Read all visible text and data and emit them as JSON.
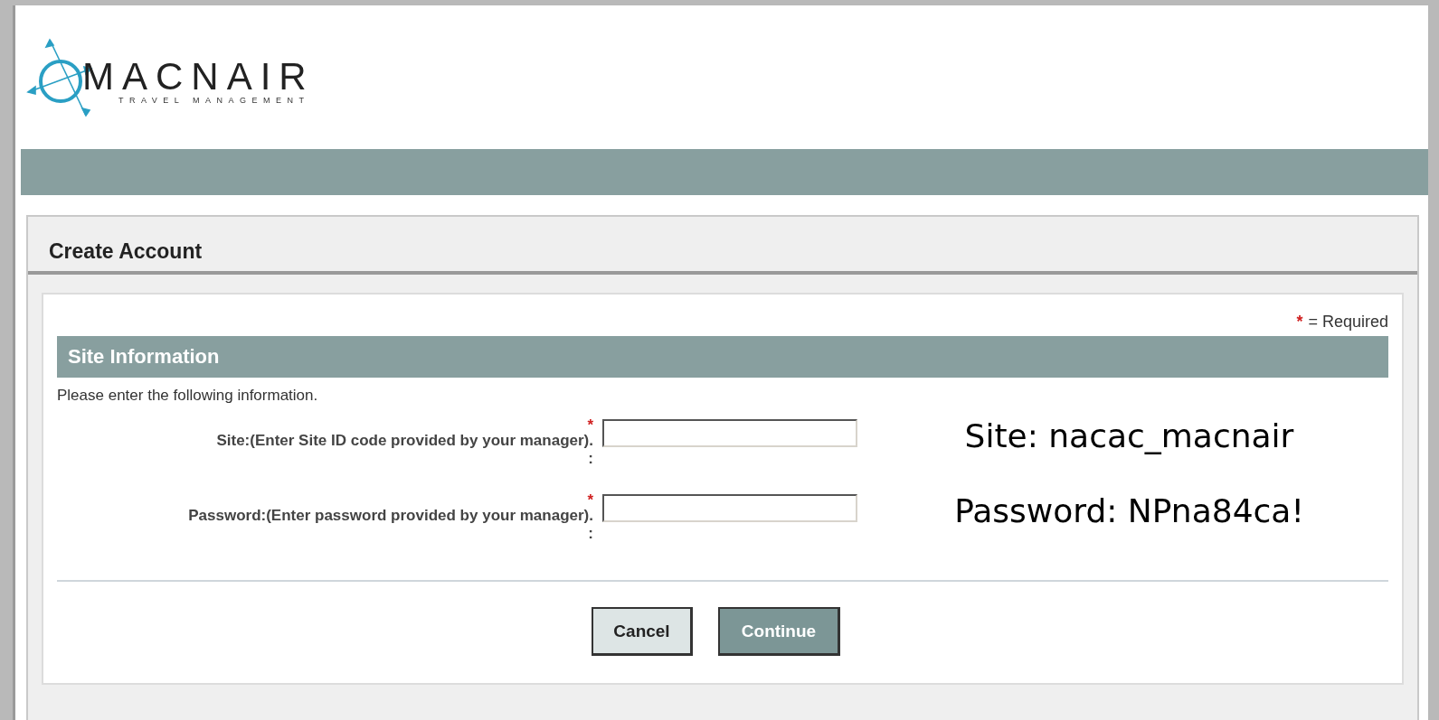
{
  "logo": {
    "name": "MACNAIR",
    "tagline": "TRAVEL MANAGEMENT"
  },
  "panel": {
    "title": "Create Account"
  },
  "required_note": {
    "mark": "*",
    "text": "= Required"
  },
  "section": {
    "title": "Site Information",
    "intro": "Please enter the following information."
  },
  "fields": [
    {
      "label": "Site:(Enter Site ID code provided by your manager).",
      "colon": ":",
      "required_mark": "*",
      "required": true,
      "annotation": "Site: nacac_macnair"
    },
    {
      "label": "Password:(Enter password provided by your manager).",
      "colon": ":",
      "required_mark": "*",
      "required": true,
      "annotation": "Password: NPna84ca!"
    }
  ],
  "buttons": [
    {
      "label": "Cancel",
      "kind": "secondary"
    },
    {
      "label": "Continue",
      "kind": "primary"
    }
  ]
}
